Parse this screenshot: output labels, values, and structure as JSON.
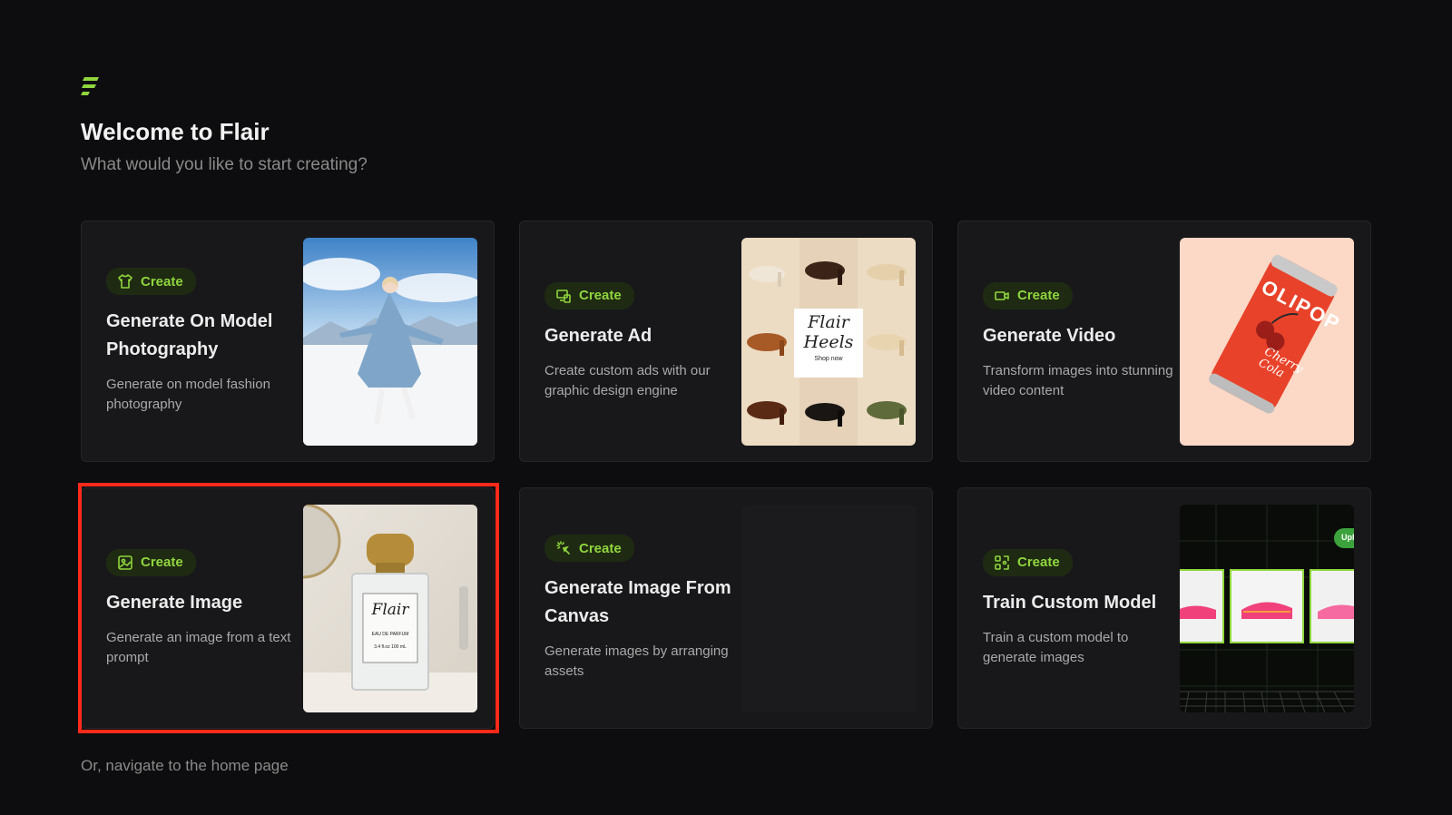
{
  "header": {
    "logo_icon": "flair-logo-icon",
    "title": "Welcome to Flair",
    "subtitle": "What would you like to start creating?"
  },
  "colors": {
    "background": "#0d0d0f",
    "card": "#18181b",
    "accent": "#8fd63e",
    "badge_bg": "#1f2a12",
    "highlight": "#ff2a1a"
  },
  "cards": [
    {
      "badge": "Create",
      "icon": "shirt-icon",
      "title": "Generate On Model Photography",
      "description": "Generate on model fashion photography"
    },
    {
      "badge": "Create",
      "icon": "ad-screens-icon",
      "title": "Generate Ad",
      "description": "Create custom ads with our graphic design engine",
      "thumb_text": {
        "brand_line1": "Flair",
        "brand_line2": "Heels",
        "cta": "Shop now"
      }
    },
    {
      "badge": "Create",
      "icon": "video-camera-icon",
      "title": "Generate Video",
      "description": "Transform images into stunning video content",
      "thumb_text": {
        "brand": "OLIPOP",
        "flavor_line1": "Cherry",
        "flavor_line2": "Cola"
      }
    },
    {
      "badge": "Create",
      "icon": "image-icon",
      "title": "Generate Image",
      "description": "Generate an image from a text prompt",
      "thumb_text": {
        "brand": "Flair",
        "label": "EAU DE PARFUM",
        "size": "3.4 fl.oz 100 mL"
      }
    },
    {
      "badge": "Create",
      "icon": "sparkle-click-icon",
      "title": "Generate Image From Canvas",
      "description": "Generate images by arranging assets"
    },
    {
      "badge": "Create",
      "icon": "train-model-icon",
      "title": "Train Custom Model",
      "description": "Train a custom model to generate images",
      "thumb_text": {
        "tag": "Upl"
      }
    }
  ],
  "footer": {
    "link": "Or, navigate to the home page"
  }
}
